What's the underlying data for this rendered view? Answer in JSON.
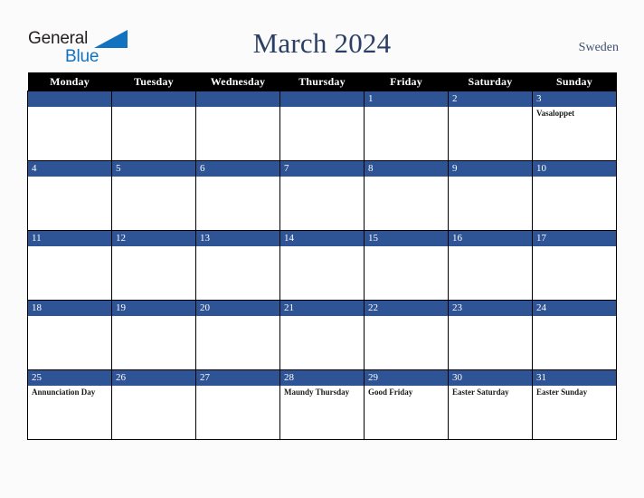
{
  "brand": {
    "name_part1": "General",
    "name_part2": "Blue",
    "triangle_color": "#1272c0"
  },
  "header": {
    "title": "March 2024",
    "country": "Sweden"
  },
  "calendar": {
    "weekdays": [
      "Monday",
      "Tuesday",
      "Wednesday",
      "Thursday",
      "Friday",
      "Saturday",
      "Sunday"
    ],
    "accent_color": "#2e5496",
    "header_bg": "#000000",
    "weeks": [
      [
        {
          "day": "",
          "events": []
        },
        {
          "day": "",
          "events": []
        },
        {
          "day": "",
          "events": []
        },
        {
          "day": "",
          "events": []
        },
        {
          "day": "1",
          "events": []
        },
        {
          "day": "2",
          "events": []
        },
        {
          "day": "3",
          "events": [
            "Vasaloppet"
          ]
        }
      ],
      [
        {
          "day": "4",
          "events": []
        },
        {
          "day": "5",
          "events": []
        },
        {
          "day": "6",
          "events": []
        },
        {
          "day": "7",
          "events": []
        },
        {
          "day": "8",
          "events": []
        },
        {
          "day": "9",
          "events": []
        },
        {
          "day": "10",
          "events": []
        }
      ],
      [
        {
          "day": "11",
          "events": []
        },
        {
          "day": "12",
          "events": []
        },
        {
          "day": "13",
          "events": []
        },
        {
          "day": "14",
          "events": []
        },
        {
          "day": "15",
          "events": []
        },
        {
          "day": "16",
          "events": []
        },
        {
          "day": "17",
          "events": []
        }
      ],
      [
        {
          "day": "18",
          "events": []
        },
        {
          "day": "19",
          "events": []
        },
        {
          "day": "20",
          "events": []
        },
        {
          "day": "21",
          "events": []
        },
        {
          "day": "22",
          "events": []
        },
        {
          "day": "23",
          "events": []
        },
        {
          "day": "24",
          "events": []
        }
      ],
      [
        {
          "day": "25",
          "events": [
            "Annunciation Day"
          ]
        },
        {
          "day": "26",
          "events": []
        },
        {
          "day": "27",
          "events": []
        },
        {
          "day": "28",
          "events": [
            "Maundy Thursday"
          ]
        },
        {
          "day": "29",
          "events": [
            "Good Friday"
          ]
        },
        {
          "day": "30",
          "events": [
            "Easter Saturday"
          ]
        },
        {
          "day": "31",
          "events": [
            "Easter Sunday"
          ]
        }
      ]
    ]
  }
}
